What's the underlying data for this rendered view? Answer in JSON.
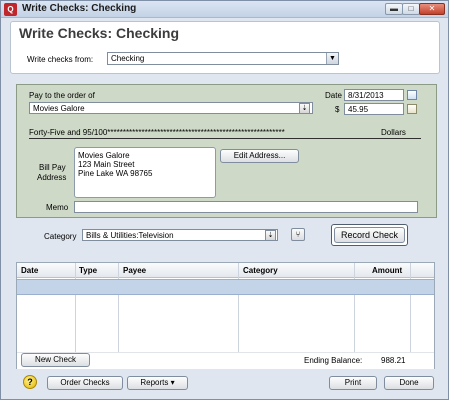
{
  "window": {
    "title": "Write Checks: Checking",
    "app_icon": "Q",
    "controls": {
      "minimize": "▬",
      "maximize": "□",
      "close": "✕"
    }
  },
  "header": {
    "title": "Write Checks: Checking",
    "from_label": "Write checks from:",
    "account": "Checking"
  },
  "check": {
    "pay_to_label": "Pay to the order of",
    "payee": "Movies Galore",
    "date_label": "Date",
    "date": "8/31/2013",
    "dollar_sign": "$",
    "amount": "45.95",
    "amount_words": "Forty-Five and 95/100*********************************************************",
    "dollars_label": "Dollars",
    "bill_pay_label_1": "Bill Pay",
    "bill_pay_label_2": "Address",
    "address_lines": [
      "Movies Galore",
      "123 Main Street",
      "Pine Lake WA 98765"
    ],
    "edit_address_label": "Edit Address...",
    "memo_label": "Memo",
    "memo": ""
  },
  "category": {
    "label": "Category",
    "value": "Bills & Utilities:Television",
    "record_label": "Record Check"
  },
  "register": {
    "columns": [
      "Date",
      "Type",
      "Payee",
      "Category",
      "Amount"
    ],
    "rows": [],
    "new_check_label": "New Check",
    "ending_balance_label": "Ending Balance:",
    "ending_balance": "988.21"
  },
  "footer": {
    "help_icon": "?",
    "order_checks_label": "Order Checks",
    "reports_label": "Reports ▾",
    "print_label": "Print",
    "done_label": "Done"
  },
  "colors": {
    "check_background": "#cfd9c8",
    "selected_row": "#c3d4e8",
    "window_background": "#dfe6ef"
  }
}
